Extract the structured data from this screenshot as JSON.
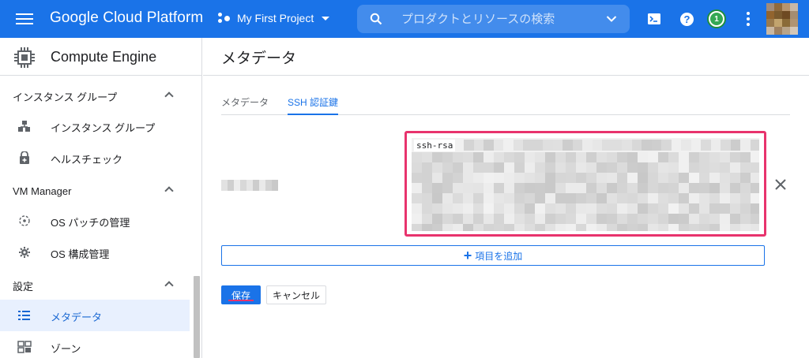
{
  "topbar": {
    "brand": "Google Cloud Platform",
    "project": "My First Project",
    "search_placeholder": "プロダクトとリソースの検索",
    "notification_count": "1",
    "color": "#1a73e8",
    "icons": [
      "menu-icon",
      "project-icon",
      "search-icon",
      "chevron-down-icon",
      "cloud-shell-icon",
      "help-icon",
      "notification-icon",
      "more-vert-icon",
      "avatar"
    ]
  },
  "sidebar": {
    "title": "Compute Engine",
    "sections": [
      {
        "label": "インスタンス グループ",
        "items": [
          {
            "label": "インスタンス グループ",
            "icon": "instance-group-icon"
          },
          {
            "label": "ヘルスチェック",
            "icon": "health-check-icon"
          }
        ]
      },
      {
        "label": "VM Manager",
        "items": [
          {
            "label": "OS パッチの管理",
            "icon": "os-patch-icon"
          },
          {
            "label": "OS 構成管理",
            "icon": "os-config-icon"
          }
        ]
      },
      {
        "label": "設定",
        "items": [
          {
            "label": "メタデータ",
            "icon": "metadata-icon",
            "active": true
          },
          {
            "label": "ゾーン",
            "icon": "zones-icon"
          }
        ]
      }
    ]
  },
  "main": {
    "page_title": "メタデータ",
    "tabs": [
      {
        "label": "メタデータ",
        "active": false
      },
      {
        "label": "SSH 認証鍵",
        "active": true
      }
    ],
    "ssh_key": {
      "prefix": "ssh-rsa",
      "highlight_color": "#e8336d"
    },
    "add_item_label": "項目を追加",
    "save_label": "保存",
    "cancel_label": "キャンセル"
  }
}
